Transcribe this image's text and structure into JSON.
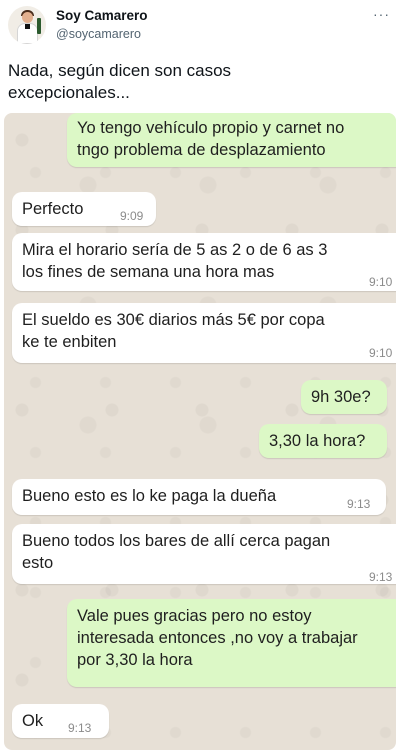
{
  "tweet": {
    "name": "Soy Camarero",
    "handle": "@soycamarero",
    "more": "···",
    "text": "Nada, según dicen son casos\nexcepcionales..."
  },
  "chat": {
    "messages": [
      {
        "direction": "out",
        "text": "Yo tengo vehículo propio y carnet no\ntngo problema de desplazamiento",
        "time": ""
      },
      {
        "direction": "in",
        "text": "Perfecto",
        "time": "9:09"
      },
      {
        "direction": "in",
        "text": "Mira el horario sería de 5 as 2 o de 6 as 3\nlos fines de semana una hora mas",
        "time": "9:10"
      },
      {
        "direction": "in",
        "text": "El sueldo es 30€ diarios más 5€ por copa\nke te enbiten",
        "time": "9:10"
      },
      {
        "direction": "out",
        "text": "9h 30e?",
        "time": ""
      },
      {
        "direction": "out",
        "text": "3,30 la hora?",
        "time": ""
      },
      {
        "direction": "in",
        "text": "Bueno esto es lo ke paga la dueña",
        "time": "9:13"
      },
      {
        "direction": "in",
        "text": "Bueno todos los bares de allí cerca pagan\nesto",
        "time": "9:13"
      },
      {
        "direction": "out",
        "text": "Vale pues gracias pero no estoy\ninteresada entonces ,no voy a trabajar\npor 3,30 la hora",
        "time": ""
      },
      {
        "direction": "in",
        "text": "Ok",
        "time": "9:13"
      }
    ]
  }
}
